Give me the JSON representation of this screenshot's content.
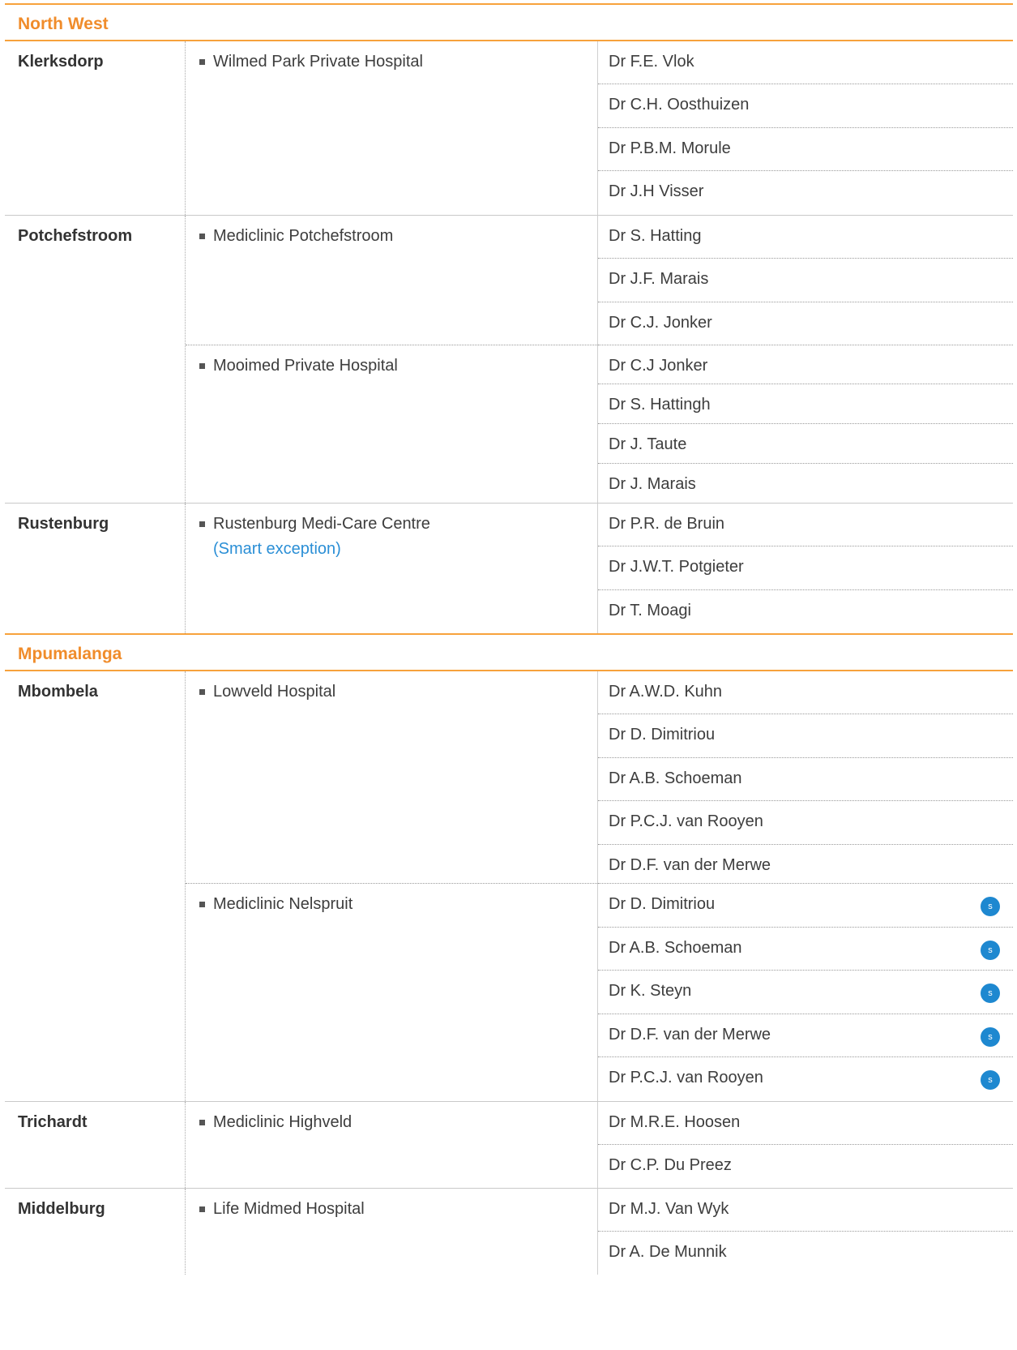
{
  "regions": [
    {
      "title": "North West",
      "cities": [
        {
          "name": "Klerksdorp",
          "facilities": [
            {
              "name": "Wilmed Park Private Hospital",
              "doctors": [
                {
                  "name": "Dr F.E. Vlok"
                },
                {
                  "name": "Dr C.H. Oosthuizen"
                },
                {
                  "name": "Dr P.B.M. Morule"
                },
                {
                  "name": "Dr J.H Visser"
                }
              ]
            }
          ]
        },
        {
          "name": "Potchefstroom",
          "facilities": [
            {
              "name": "Mediclinic Potchefstroom",
              "doctors": [
                {
                  "name": "Dr S. Hatting"
                },
                {
                  "name": "Dr J.F. Marais"
                },
                {
                  "name": "Dr C.J. Jonker"
                }
              ]
            },
            {
              "name": "Mooimed Private Hospital",
              "doctors": [
                {
                  "name": "Dr C.J Jonker"
                },
                {
                  "name": "Dr S. Hattingh"
                },
                {
                  "name": "Dr J. Taute"
                },
                {
                  "name": "Dr J. Marais"
                }
              ]
            }
          ]
        },
        {
          "name": "Rustenburg",
          "facilities": [
            {
              "name": "Rustenburg Medi-Care Centre",
              "note": "(Smart exception)",
              "doctors": [
                {
                  "name": "Dr P.R. de Bruin"
                },
                {
                  "name": "Dr J.W.T. Potgieter"
                },
                {
                  "name": "Dr T. Moagi"
                }
              ]
            }
          ]
        }
      ]
    },
    {
      "title": "Mpumalanga",
      "cities": [
        {
          "name": "Mbombela",
          "facilities": [
            {
              "name": "Lowveld Hospital",
              "doctors": [
                {
                  "name": "Dr A.W.D. Kuhn"
                },
                {
                  "name": "Dr D. Dimitriou"
                },
                {
                  "name": "Dr A.B. Schoeman"
                },
                {
                  "name": "Dr P.C.J. van Rooyen"
                },
                {
                  "name": "Dr D.F. van der Merwe"
                }
              ]
            },
            {
              "name": "Mediclinic Nelspruit",
              "doctors": [
                {
                  "name": "Dr D. Dimitriou",
                  "badge": "s"
                },
                {
                  "name": "Dr A.B. Schoeman",
                  "badge": "s"
                },
                {
                  "name": "Dr K. Steyn",
                  "badge": "s"
                },
                {
                  "name": "Dr D.F. van der Merwe",
                  "badge": "s"
                },
                {
                  "name": "Dr P.C.J. van Rooyen",
                  "badge": "s"
                }
              ]
            }
          ]
        },
        {
          "name": "Trichardt",
          "facilities": [
            {
              "name": "Mediclinic Highveld",
              "doctors": [
                {
                  "name": "Dr M.R.E. Hoosen"
                },
                {
                  "name": "Dr C.P. Du Preez"
                }
              ]
            }
          ]
        },
        {
          "name": "Middelburg",
          "facilities": [
            {
              "name": "Life Midmed Hospital",
              "doctors": [
                {
                  "name": "Dr M.J. Van Wyk"
                },
                {
                  "name": "Dr A. De Munnik"
                }
              ]
            }
          ]
        }
      ]
    }
  ]
}
